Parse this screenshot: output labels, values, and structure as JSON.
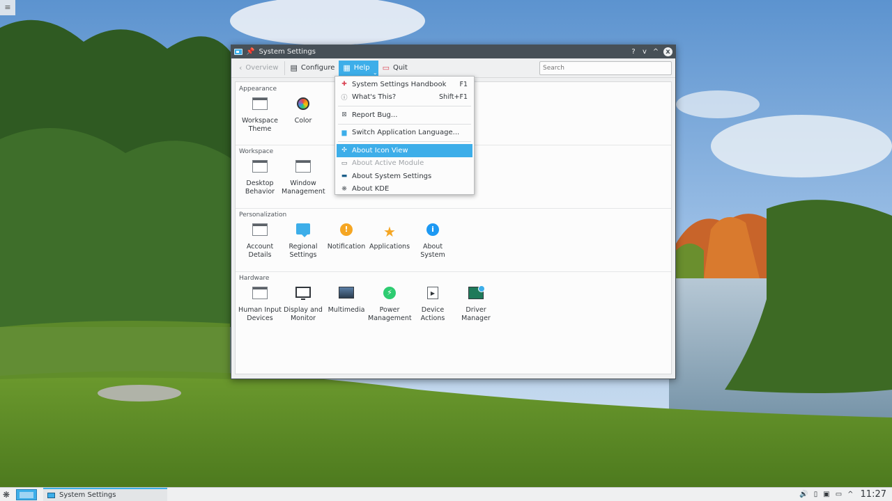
{
  "desktop": {
    "corner_icon": "hamburger-icon"
  },
  "window": {
    "title": "System Settings",
    "buttons": {
      "help": "?",
      "minimize": "v",
      "maximize": "^",
      "close": "x"
    }
  },
  "toolbar": {
    "overview": "Overview",
    "configure": "Configure",
    "help": "Help",
    "quit": "Quit",
    "search_placeholder": "Search"
  },
  "categories": [
    {
      "title": "Appearance",
      "items": [
        {
          "label": "Workspace Theme",
          "icon": "window-icon"
        },
        {
          "label": "Color",
          "icon": "color-wheel-icon"
        }
      ]
    },
    {
      "title": "Workspace",
      "items": [
        {
          "label": "Desktop Behavior",
          "icon": "window-icon"
        },
        {
          "label": "Window Management",
          "icon": "window-icon"
        }
      ]
    },
    {
      "title": "Personalization",
      "items": [
        {
          "label": "Account Details",
          "icon": "window-icon"
        },
        {
          "label": "Regional Settings",
          "icon": "speech-bubble-icon"
        },
        {
          "label": "Notification",
          "icon": "exclamation-icon"
        },
        {
          "label": "Applications",
          "icon": "star-icon"
        },
        {
          "label": "About System",
          "icon": "info-icon"
        }
      ]
    },
    {
      "title": "Hardware",
      "items": [
        {
          "label": "Human Input Devices",
          "icon": "keyboard-icon"
        },
        {
          "label": "Display and Monitor",
          "icon": "monitor-icon"
        },
        {
          "label": "Multimedia",
          "icon": "multimedia-icon"
        },
        {
          "label": "Power Management",
          "icon": "power-icon"
        },
        {
          "label": "Device Actions",
          "icon": "device-icon"
        },
        {
          "label": "Driver Manager",
          "icon": "driver-icon"
        }
      ]
    }
  ],
  "help_menu": {
    "items": [
      {
        "label": "System Settings Handbook",
        "shortcut": "F1"
      },
      {
        "label": "What's This?",
        "shortcut": "Shift+F1"
      },
      {
        "label": "Report Bug...",
        "shortcut": ""
      },
      {
        "label": "Switch Application Language...",
        "shortcut": ""
      },
      {
        "label": "About Icon View",
        "shortcut": ""
      },
      {
        "label": "About Active Module",
        "shortcut": ""
      },
      {
        "label": "About System Settings",
        "shortcut": ""
      },
      {
        "label": "About KDE",
        "shortcut": ""
      }
    ]
  },
  "taskbar": {
    "task_title": "System Settings",
    "clock": "11:27"
  },
  "colors": {
    "accent": "#3daee9",
    "titlebar": "#475057"
  }
}
